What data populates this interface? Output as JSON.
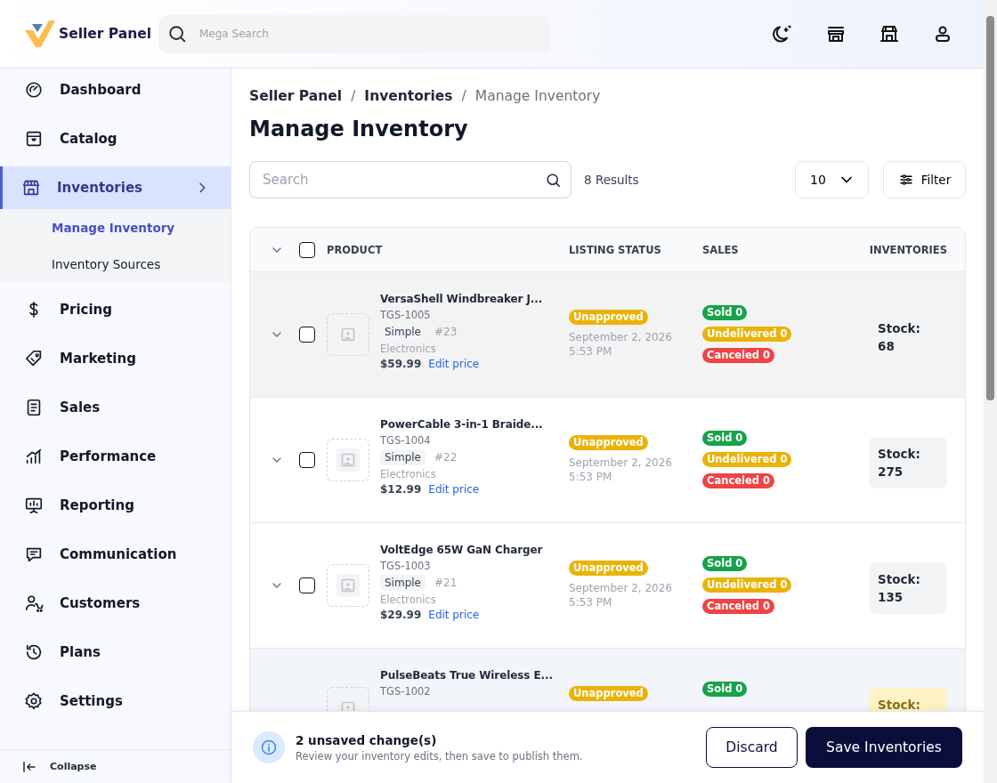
{
  "header": {
    "brand": "Seller Panel",
    "search": {
      "placeholder": "Mega Search"
    }
  },
  "sidebar": {
    "items": [
      {
        "label": "Dashboard",
        "selected": false
      },
      {
        "label": "Catalog",
        "selected": false
      },
      {
        "label": "Inventories",
        "selected": true,
        "expanded": true,
        "children": [
          {
            "label": "Manage Inventory",
            "selected": true
          },
          {
            "label": "Inventory Sources",
            "selected": false
          }
        ]
      },
      {
        "label": "Pricing",
        "selected": false
      },
      {
        "label": "Marketing",
        "selected": false
      },
      {
        "label": "Sales",
        "selected": false
      },
      {
        "label": "Performance",
        "selected": false
      },
      {
        "label": "Reporting",
        "selected": false
      },
      {
        "label": "Communication",
        "selected": false
      },
      {
        "label": "Customers",
        "selected": false
      },
      {
        "label": "Plans",
        "selected": false
      },
      {
        "label": "Settings",
        "selected": false
      }
    ],
    "collapse": "Collapse"
  },
  "breadcrumbs": [
    {
      "kind": "link",
      "label": "Seller Panel"
    },
    {
      "kind": "separator",
      "label": "/"
    },
    {
      "kind": "link",
      "label": "Inventories"
    },
    {
      "kind": "separator",
      "label": "/"
    },
    {
      "kind": "current",
      "label": "Manage Inventory"
    }
  ],
  "page_title": "Manage Inventory",
  "toolbar": {
    "search": {
      "placeholder": "Search"
    },
    "results": "8 Results",
    "per_page": "10",
    "filter": "Filter"
  },
  "table": {
    "header_checked": false,
    "columns": [
      "PRODUCT",
      "LISTING STATUS",
      "SALES",
      "INVENTORIES"
    ],
    "rows": [
      {
        "hovered": true,
        "edited": false,
        "expanded": false,
        "checked": false,
        "name": "VersaShell Windbreaker J...",
        "sku": "TGS-1005",
        "type": "Simple",
        "number": "#23",
        "category": "Electronics",
        "price": "$59.99",
        "edit_link": "Edit price",
        "status": {
          "label": "Unapproved",
          "color": "#eab308"
        },
        "date": "September 2, 2026",
        "time": "5:53 PM",
        "sales": [
          {
            "label": "Sold 0",
            "color": "#16a34a"
          },
          {
            "label": "Undelivered 0",
            "color": "#eab308"
          },
          {
            "label": "Canceled 0",
            "color": "#ef4444"
          }
        ],
        "stock_label": "Stock:",
        "stock": "68"
      },
      {
        "hovered": false,
        "edited": false,
        "expanded": false,
        "checked": false,
        "name": "PowerCable 3-in-1 Braide...",
        "sku": "TGS-1004",
        "type": "Simple",
        "number": "#22",
        "category": "Electronics",
        "price": "$12.99",
        "edit_link": "Edit price",
        "status": {
          "label": "Unapproved",
          "color": "#eab308"
        },
        "date": "September 2, 2026",
        "time": "5:53 PM",
        "sales": [
          {
            "label": "Sold 0",
            "color": "#16a34a"
          },
          {
            "label": "Undelivered 0",
            "color": "#eab308"
          },
          {
            "label": "Canceled 0",
            "color": "#ef4444"
          }
        ],
        "stock_label": "Stock:",
        "stock": "275"
      },
      {
        "hovered": false,
        "edited": false,
        "expanded": false,
        "checked": false,
        "name": "VoltEdge 65W GaN Charger",
        "sku": "TGS-1003",
        "type": "Simple",
        "number": "#21",
        "category": "Electronics",
        "price": "$29.99",
        "edit_link": "Edit price",
        "status": {
          "label": "Unapproved",
          "color": "#eab308"
        },
        "date": "September 2, 2026",
        "time": "5:53 PM",
        "sales": [
          {
            "label": "Sold 0",
            "color": "#16a34a"
          },
          {
            "label": "Undelivered 0",
            "color": "#eab308"
          },
          {
            "label": "Canceled 0",
            "color": "#ef4444"
          }
        ],
        "stock_label": "Stock:",
        "stock": "135"
      },
      {
        "hovered": false,
        "edited": true,
        "name": "PulseBeats True Wireless E...",
        "sku": "TGS-1002",
        "status": {
          "label": "Unapproved",
          "color": "#eab308"
        },
        "sales": [
          {
            "label": "Sold 0",
            "color": "#16a34a"
          }
        ],
        "stock_label": "Stock:"
      }
    ]
  },
  "save_bar": {
    "title": "2 unsaved change(s)",
    "message": "Review your inventory edits, then save to publish them.",
    "discard": "Discard",
    "save": "Save Inventories"
  }
}
